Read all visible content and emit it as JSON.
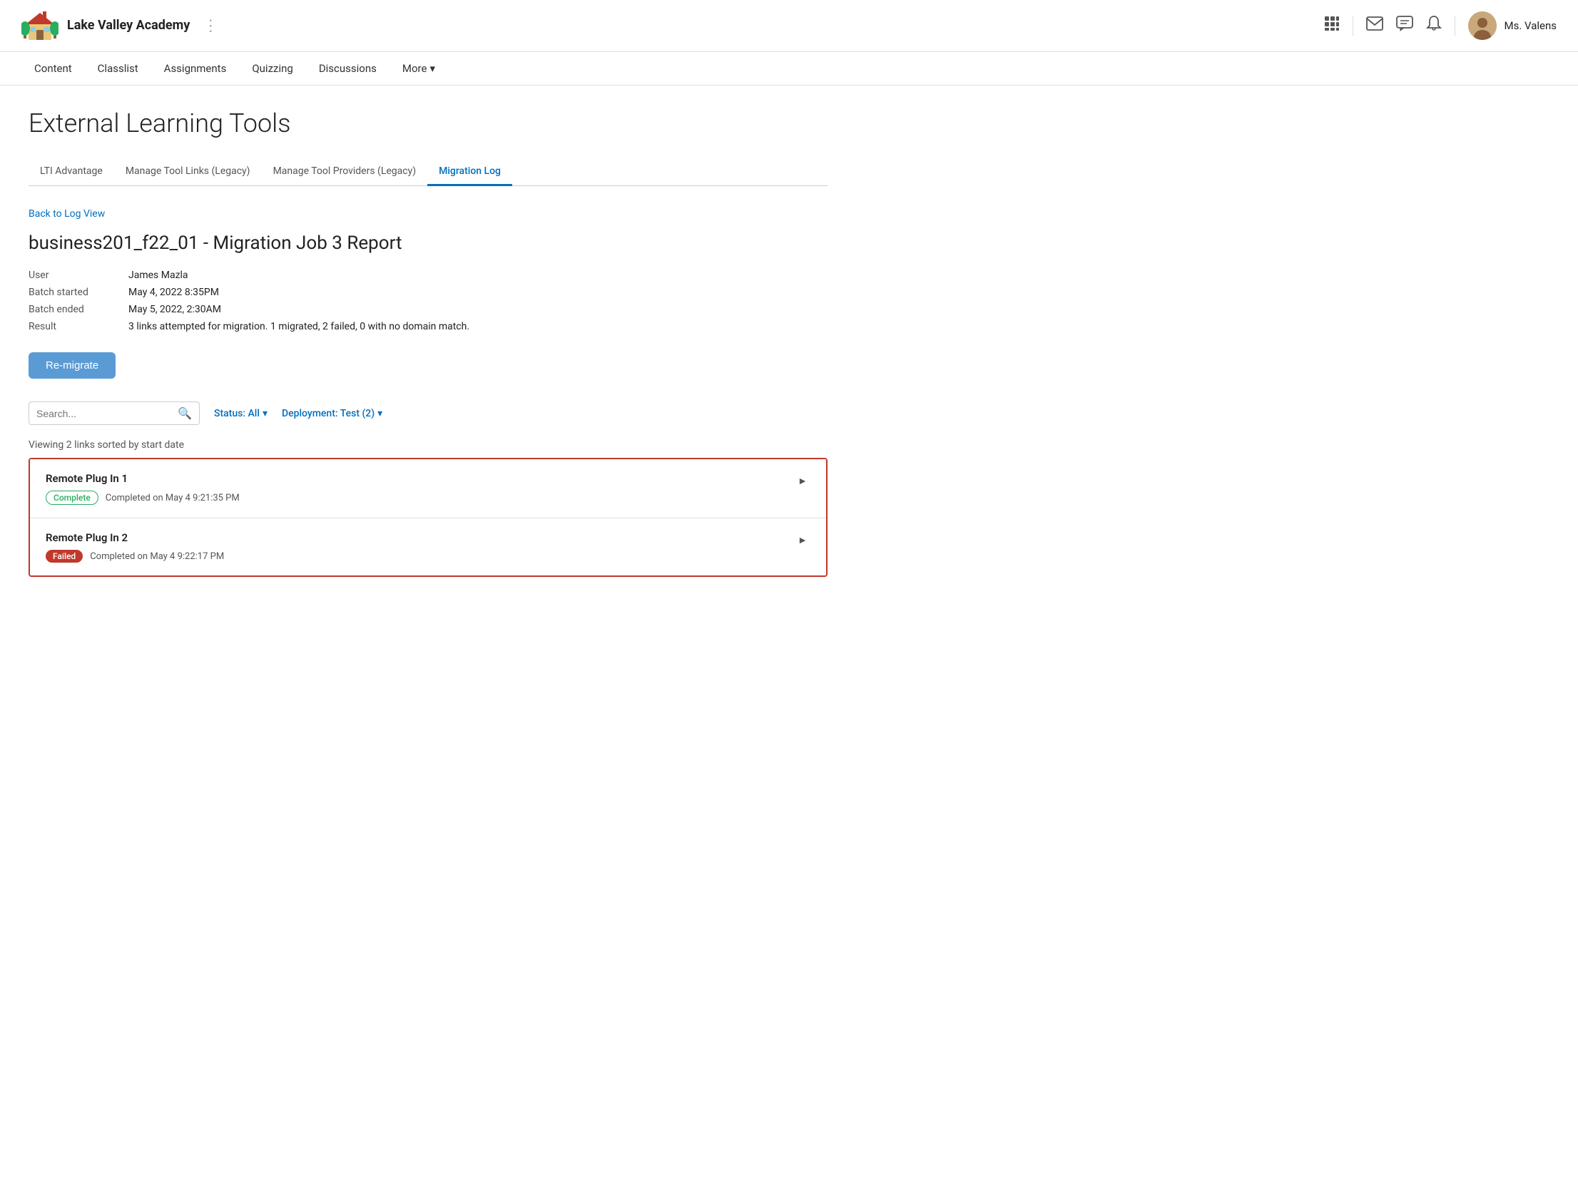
{
  "header": {
    "school_name": "Lake Valley Academy",
    "user_name": "Ms. Valens",
    "dots_label": "⋮"
  },
  "nav": {
    "items": [
      {
        "label": "Content",
        "active": false
      },
      {
        "label": "Classlist",
        "active": false
      },
      {
        "label": "Assignments",
        "active": false
      },
      {
        "label": "Quizzing",
        "active": false
      },
      {
        "label": "Discussions",
        "active": false
      }
    ],
    "more_label": "More",
    "more_icon": "▾"
  },
  "page": {
    "title": "External Learning Tools"
  },
  "tabs": [
    {
      "label": "LTI Advantage",
      "active": false
    },
    {
      "label": "Manage Tool Links (Legacy)",
      "active": false
    },
    {
      "label": "Manage Tool Providers (Legacy)",
      "active": false
    },
    {
      "label": "Migration Log",
      "active": true
    }
  ],
  "back_link": "Back to Log View",
  "report": {
    "title": "business201_f22_01 - Migration Job 3 Report",
    "fields": [
      {
        "label": "User",
        "value": "James Mazla"
      },
      {
        "label": "Batch started",
        "value": "May 4, 2022 8:35PM"
      },
      {
        "label": "Batch ended",
        "value": "May 5, 2022, 2:30AM"
      },
      {
        "label": "Result",
        "value": "3 links attempted for migration. 1 migrated, 2 failed, 0 with no domain match."
      }
    ],
    "remigrate_label": "Re-migrate"
  },
  "search": {
    "placeholder": "Search..."
  },
  "filters": [
    {
      "label": "Status: All",
      "icon": "▾"
    },
    {
      "label": "Deployment: Test (2)",
      "icon": "▾"
    }
  ],
  "viewing_text": "Viewing 2 links sorted by start date",
  "links": [
    {
      "name": "Remote Plug In 1",
      "badge": "Complete",
      "badge_type": "complete",
      "date_text": "Completed on May 4 9:21:35 PM"
    },
    {
      "name": "Remote Plug In 2",
      "badge": "Failed",
      "badge_type": "failed",
      "date_text": "Completed on May 4 9:22:17 PM"
    }
  ]
}
